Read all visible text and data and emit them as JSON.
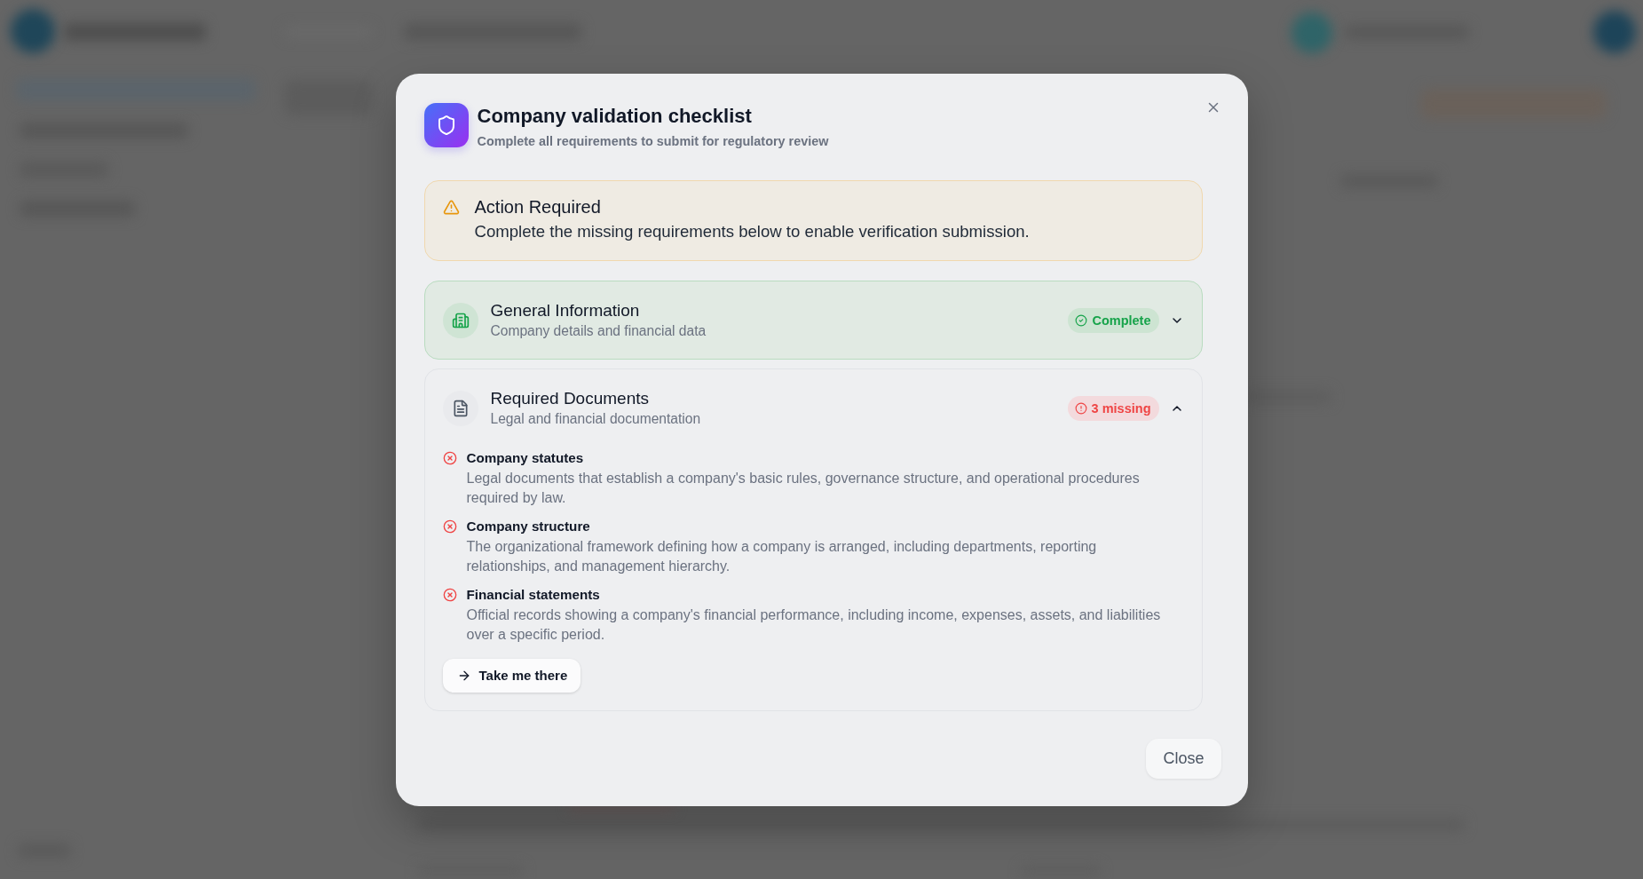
{
  "dialog": {
    "title": "Company validation checklist",
    "subtitle": "Complete all requirements to submit for regulatory review"
  },
  "alert": {
    "title": "Action Required",
    "message": "Complete the missing requirements below to enable verification submission."
  },
  "sections": [
    {
      "title": "General Information",
      "subtitle": "Company details and financial data",
      "complete": true,
      "badge": "Complete",
      "expanded": false
    },
    {
      "title": "Required Documents",
      "subtitle": "Legal and financial documentation",
      "complete": false,
      "badge": "3 missing",
      "expanded": true,
      "items": [
        {
          "title": "Company statutes",
          "description": "Legal documents that establish a company's basic rules, governance structure, and operational procedures required by law.",
          "complete": false
        },
        {
          "title": "Company structure",
          "description": "The organizational framework defining how a company is arranged, including departments, reporting relationships, and management hierarchy.",
          "complete": false
        },
        {
          "title": "Financial statements",
          "description": "Official records showing a company's financial performance, including income, expenses, assets, and liabilities over a specific period.",
          "complete": false
        }
      ],
      "action_button": "Take me there"
    }
  ],
  "footer": {
    "close_button": "Close"
  }
}
